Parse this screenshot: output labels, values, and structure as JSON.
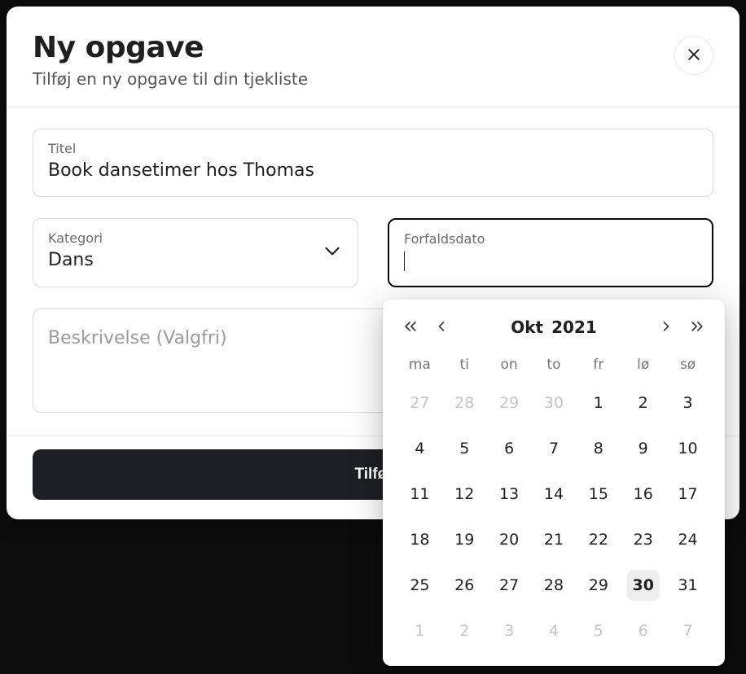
{
  "header": {
    "title": "Ny opgave",
    "subtitle": "Tilføj en ny opgave til din tjekliste"
  },
  "fields": {
    "title_label": "Titel",
    "title_value": "Book dansetimer hos Thomas",
    "category_label": "Kategori",
    "category_value": "Dans",
    "duedate_label": "Forfaldsdato",
    "description_placeholder": "Beskrivelse (Valgfri)"
  },
  "submit_label": "Tilføj",
  "datepicker": {
    "month": "Okt",
    "year": "2021",
    "dow": [
      "ma",
      "ti",
      "on",
      "to",
      "fr",
      "lø",
      "sø"
    ],
    "weeks": [
      [
        {
          "d": 27,
          "out": true
        },
        {
          "d": 28,
          "out": true
        },
        {
          "d": 29,
          "out": true
        },
        {
          "d": 30,
          "out": true
        },
        {
          "d": 1
        },
        {
          "d": 2
        },
        {
          "d": 3
        }
      ],
      [
        {
          "d": 4
        },
        {
          "d": 5
        },
        {
          "d": 6
        },
        {
          "d": 7
        },
        {
          "d": 8
        },
        {
          "d": 9
        },
        {
          "d": 10
        }
      ],
      [
        {
          "d": 11
        },
        {
          "d": 12
        },
        {
          "d": 13
        },
        {
          "d": 14
        },
        {
          "d": 15
        },
        {
          "d": 16
        },
        {
          "d": 17
        }
      ],
      [
        {
          "d": 18
        },
        {
          "d": 19
        },
        {
          "d": 20
        },
        {
          "d": 21
        },
        {
          "d": 22
        },
        {
          "d": 23
        },
        {
          "d": 24
        }
      ],
      [
        {
          "d": 25
        },
        {
          "d": 26
        },
        {
          "d": 27
        },
        {
          "d": 28
        },
        {
          "d": 29
        },
        {
          "d": 30,
          "hover": true
        },
        {
          "d": 31
        }
      ],
      [
        {
          "d": 1,
          "out": true
        },
        {
          "d": 2,
          "out": true
        },
        {
          "d": 3,
          "out": true
        },
        {
          "d": 4,
          "out": true
        },
        {
          "d": 5,
          "out": true
        },
        {
          "d": 6,
          "out": true
        },
        {
          "d": 7,
          "out": true
        }
      ]
    ]
  }
}
